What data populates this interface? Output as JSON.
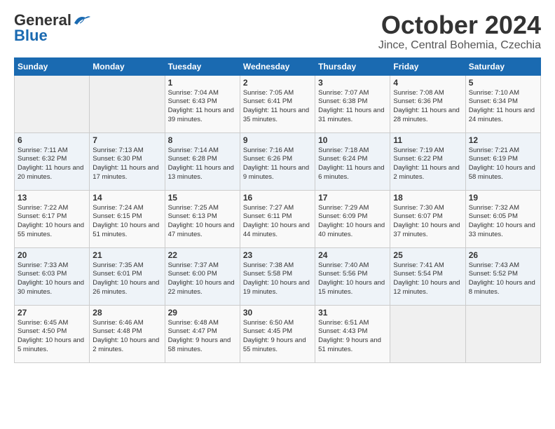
{
  "header": {
    "logo_general": "General",
    "logo_blue": "Blue",
    "month": "October 2024",
    "location": "Jince, Central Bohemia, Czechia"
  },
  "days_of_week": [
    "Sunday",
    "Monday",
    "Tuesday",
    "Wednesday",
    "Thursday",
    "Friday",
    "Saturday"
  ],
  "weeks": [
    [
      {
        "day": "",
        "content": ""
      },
      {
        "day": "",
        "content": ""
      },
      {
        "day": "1",
        "content": "Sunrise: 7:04 AM\nSunset: 6:43 PM\nDaylight: 11 hours and 39 minutes."
      },
      {
        "day": "2",
        "content": "Sunrise: 7:05 AM\nSunset: 6:41 PM\nDaylight: 11 hours and 35 minutes."
      },
      {
        "day": "3",
        "content": "Sunrise: 7:07 AM\nSunset: 6:38 PM\nDaylight: 11 hours and 31 minutes."
      },
      {
        "day": "4",
        "content": "Sunrise: 7:08 AM\nSunset: 6:36 PM\nDaylight: 11 hours and 28 minutes."
      },
      {
        "day": "5",
        "content": "Sunrise: 7:10 AM\nSunset: 6:34 PM\nDaylight: 11 hours and 24 minutes."
      }
    ],
    [
      {
        "day": "6",
        "content": "Sunrise: 7:11 AM\nSunset: 6:32 PM\nDaylight: 11 hours and 20 minutes."
      },
      {
        "day": "7",
        "content": "Sunrise: 7:13 AM\nSunset: 6:30 PM\nDaylight: 11 hours and 17 minutes."
      },
      {
        "day": "8",
        "content": "Sunrise: 7:14 AM\nSunset: 6:28 PM\nDaylight: 11 hours and 13 minutes."
      },
      {
        "day": "9",
        "content": "Sunrise: 7:16 AM\nSunset: 6:26 PM\nDaylight: 11 hours and 9 minutes."
      },
      {
        "day": "10",
        "content": "Sunrise: 7:18 AM\nSunset: 6:24 PM\nDaylight: 11 hours and 6 minutes."
      },
      {
        "day": "11",
        "content": "Sunrise: 7:19 AM\nSunset: 6:22 PM\nDaylight: 11 hours and 2 minutes."
      },
      {
        "day": "12",
        "content": "Sunrise: 7:21 AM\nSunset: 6:19 PM\nDaylight: 10 hours and 58 minutes."
      }
    ],
    [
      {
        "day": "13",
        "content": "Sunrise: 7:22 AM\nSunset: 6:17 PM\nDaylight: 10 hours and 55 minutes."
      },
      {
        "day": "14",
        "content": "Sunrise: 7:24 AM\nSunset: 6:15 PM\nDaylight: 10 hours and 51 minutes."
      },
      {
        "day": "15",
        "content": "Sunrise: 7:25 AM\nSunset: 6:13 PM\nDaylight: 10 hours and 47 minutes."
      },
      {
        "day": "16",
        "content": "Sunrise: 7:27 AM\nSunset: 6:11 PM\nDaylight: 10 hours and 44 minutes."
      },
      {
        "day": "17",
        "content": "Sunrise: 7:29 AM\nSunset: 6:09 PM\nDaylight: 10 hours and 40 minutes."
      },
      {
        "day": "18",
        "content": "Sunrise: 7:30 AM\nSunset: 6:07 PM\nDaylight: 10 hours and 37 minutes."
      },
      {
        "day": "19",
        "content": "Sunrise: 7:32 AM\nSunset: 6:05 PM\nDaylight: 10 hours and 33 minutes."
      }
    ],
    [
      {
        "day": "20",
        "content": "Sunrise: 7:33 AM\nSunset: 6:03 PM\nDaylight: 10 hours and 30 minutes."
      },
      {
        "day": "21",
        "content": "Sunrise: 7:35 AM\nSunset: 6:01 PM\nDaylight: 10 hours and 26 minutes."
      },
      {
        "day": "22",
        "content": "Sunrise: 7:37 AM\nSunset: 6:00 PM\nDaylight: 10 hours and 22 minutes."
      },
      {
        "day": "23",
        "content": "Sunrise: 7:38 AM\nSunset: 5:58 PM\nDaylight: 10 hours and 19 minutes."
      },
      {
        "day": "24",
        "content": "Sunrise: 7:40 AM\nSunset: 5:56 PM\nDaylight: 10 hours and 15 minutes."
      },
      {
        "day": "25",
        "content": "Sunrise: 7:41 AM\nSunset: 5:54 PM\nDaylight: 10 hours and 12 minutes."
      },
      {
        "day": "26",
        "content": "Sunrise: 7:43 AM\nSunset: 5:52 PM\nDaylight: 10 hours and 8 minutes."
      }
    ],
    [
      {
        "day": "27",
        "content": "Sunrise: 6:45 AM\nSunset: 4:50 PM\nDaylight: 10 hours and 5 minutes."
      },
      {
        "day": "28",
        "content": "Sunrise: 6:46 AM\nSunset: 4:48 PM\nDaylight: 10 hours and 2 minutes."
      },
      {
        "day": "29",
        "content": "Sunrise: 6:48 AM\nSunset: 4:47 PM\nDaylight: 9 hours and 58 minutes."
      },
      {
        "day": "30",
        "content": "Sunrise: 6:50 AM\nSunset: 4:45 PM\nDaylight: 9 hours and 55 minutes."
      },
      {
        "day": "31",
        "content": "Sunrise: 6:51 AM\nSunset: 4:43 PM\nDaylight: 9 hours and 51 minutes."
      },
      {
        "day": "",
        "content": ""
      },
      {
        "day": "",
        "content": ""
      }
    ]
  ]
}
